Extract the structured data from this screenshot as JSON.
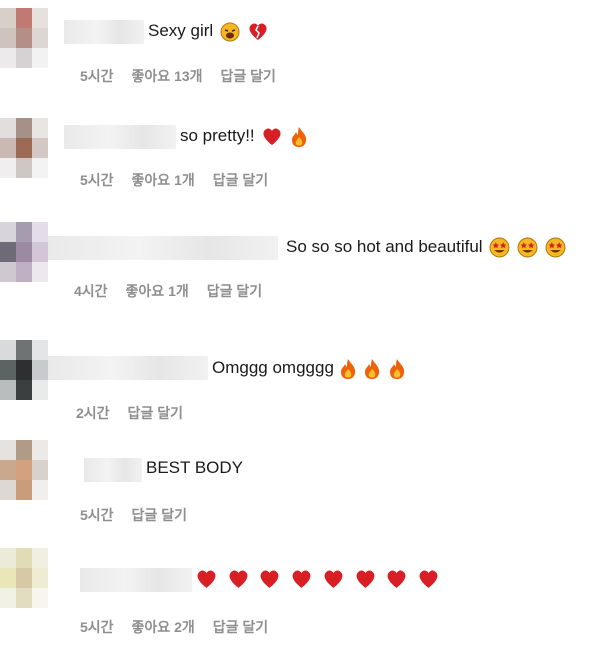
{
  "comments": [
    {
      "text": "Sexy girl",
      "time": "5시간",
      "likes": "좋아요 13개",
      "reply": "답글 달기",
      "emojis": [
        "tired-face",
        "broken-heart"
      ]
    },
    {
      "text": "so pretty!!",
      "time": "5시간",
      "likes": "좋아요 1개",
      "reply": "답글 달기",
      "emojis": [
        "heart",
        "fire"
      ]
    },
    {
      "text": "So so so hot and beautiful",
      "time": "4시간",
      "likes": "좋아요 1개",
      "reply": "답글 달기",
      "emojis": [
        "star-eyes",
        "star-eyes",
        "star-eyes"
      ]
    },
    {
      "text": "Omggg omgggg",
      "time": "2시간",
      "likes": "",
      "reply": "답글 달기",
      "emojis": [
        "fire",
        "fire",
        "fire"
      ]
    },
    {
      "text": "BEST BODY",
      "time": "5시간",
      "likes": "",
      "reply": "답글 달기",
      "emojis": []
    },
    {
      "text": "",
      "time": "5시간",
      "likes": "좋아요 2개",
      "reply": "답글 달기",
      "emojis": [
        "heart",
        "heart",
        "heart",
        "heart",
        "heart",
        "heart",
        "heart",
        "heart"
      ]
    }
  ]
}
